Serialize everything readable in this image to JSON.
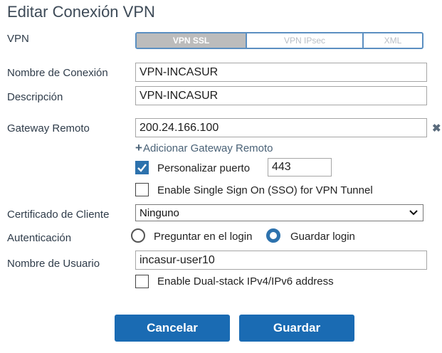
{
  "title": "Editar Conexión VPN",
  "vpn": {
    "label": "VPN",
    "options": [
      "VPN SSL",
      "VPN IPsec",
      "XML"
    ],
    "selected": "VPN SSL"
  },
  "connection_name": {
    "label": "Nombre de Conexión",
    "value": "VPN-INCASUR"
  },
  "description": {
    "label": "Descripción",
    "value": "VPN-INCASUR"
  },
  "gateway": {
    "label": "Gateway Remoto",
    "value": "200.24.166.100",
    "remove_icon": "close-icon",
    "add_label": "Adicionar Gateway Remoto"
  },
  "custom_port": {
    "label": "Personalizar puerto",
    "checked": true,
    "value": "443"
  },
  "sso": {
    "label": "Enable Single Sign On (SSO) for VPN Tunnel",
    "checked": false
  },
  "client_cert": {
    "label": "Certificado de Cliente",
    "value": "Ninguno"
  },
  "auth": {
    "label": "Autenticación",
    "options": [
      "Preguntar en el login",
      "Guardar login"
    ],
    "selected": "Guardar login"
  },
  "username": {
    "label": "Nombre de Usuario",
    "value": "incasur-user10"
  },
  "dual_stack": {
    "label": "Enable Dual-stack IPv4/IPv6 address",
    "checked": false
  },
  "buttons": {
    "cancel": "Cancelar",
    "save": "Guardar"
  },
  "colors": {
    "primary": "#1a6bb3",
    "accent_border": "#5b8fc1",
    "checkbox_on": "#2d72ad"
  }
}
